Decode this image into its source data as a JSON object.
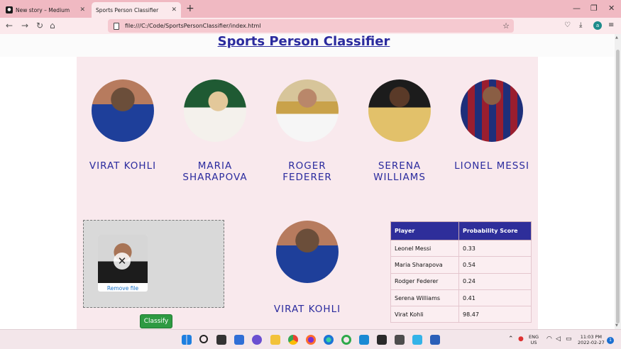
{
  "browser": {
    "tabs": [
      {
        "title": "New story – Medium",
        "favicon": "medium-icon"
      },
      {
        "title": "Sports Person Classifier",
        "favicon": "page-icon"
      }
    ],
    "url": "file:///C:/Code/SportsPersonClassifier/index.html"
  },
  "page": {
    "title": "Sports Person Classifier",
    "players": [
      {
        "name": "VIRAT KOHLI",
        "colors": [
          "#1e3f9a",
          "#5a4636"
        ]
      },
      {
        "name": "MARIA SHARAPOVA",
        "colors": [
          "#2a6a3a",
          "#e9ddd2"
        ]
      },
      {
        "name": "ROGER FEDERER",
        "colors": [
          "#c9b37a",
          "#f2f2f2"
        ]
      },
      {
        "name": "SERENA WILLIAMS",
        "colors": [
          "#2b2b2b",
          "#e8c86a"
        ]
      },
      {
        "name": "LIONEL MESSI",
        "colors": [
          "#1e2f7a",
          "#9a1e2f"
        ]
      }
    ],
    "upload": {
      "remove_label": "Remove file"
    },
    "classify_label": "Classify",
    "result": {
      "name": "VIRAT KOHLI"
    },
    "table": {
      "headers": [
        "Player",
        "Probability Score"
      ],
      "rows": [
        [
          "Leonel Messi",
          "0.33"
        ],
        [
          "Maria Sharapova",
          "0.54"
        ],
        [
          "Rodger Federer",
          "0.24"
        ],
        [
          "Serena Williams",
          "0.41"
        ],
        [
          "Virat Kohli",
          "98.47"
        ]
      ]
    }
  },
  "taskbar": {
    "lang": "ENG",
    "region": "US",
    "time": "11:03 PM",
    "date": "2022-02-27",
    "notifications": "1"
  },
  "colors": {
    "accent": "#2b2b9e",
    "classify_button": "#2e9a42",
    "panel_bg": "#f9e9ed",
    "tabbar_bg": "#f0b9c2"
  }
}
